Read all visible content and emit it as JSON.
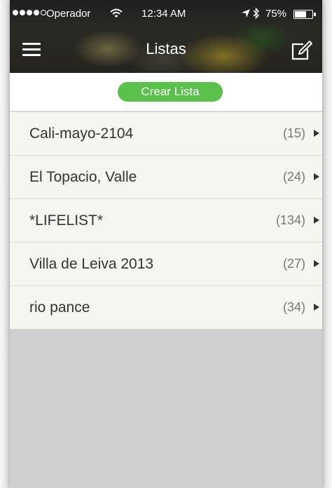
{
  "status_bar": {
    "carrier": "Operador",
    "time": "12:34 AM",
    "battery_percent": "75%",
    "battery_level": 0.75,
    "icons": [
      "signal-dots-icon",
      "wifi-icon",
      "location-arrow-icon",
      "bluetooth-icon",
      "battery-icon"
    ]
  },
  "nav": {
    "title": "Listas",
    "menu_icon": "hamburger-menu-icon",
    "compose_icon": "compose-edit-icon"
  },
  "create_button": {
    "label": "Crear Lista",
    "color": "#5ac24a"
  },
  "lists": [
    {
      "name": "Cali-mayo-2104",
      "count": "(15)"
    },
    {
      "name": "El Topacio, Valle",
      "count": "(24)"
    },
    {
      "name": "*LIFELIST*",
      "count": "(134)"
    },
    {
      "name": "Villa de Leiva 2013",
      "count": "(27)"
    },
    {
      "name": "rio pance",
      "count": "(34)"
    }
  ]
}
